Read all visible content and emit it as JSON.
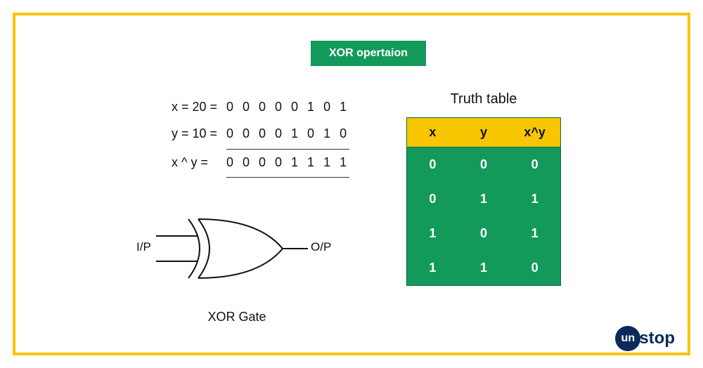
{
  "title": "XOR opertaion",
  "equations": {
    "x_label": "x = 20 =",
    "x_bits": "0 0 0 0 0 1 0 1",
    "y_label": "y = 10 =",
    "y_bits": "0 0 0 0 1 0 1 0",
    "res_label": "x ^ y  =",
    "res_bits": "0 0 0 0 1 1 1 1"
  },
  "gate": {
    "input_label": "I/P",
    "output_label": "O/P",
    "caption": "XOR Gate"
  },
  "truth": {
    "title": "Truth table",
    "headers": [
      "x",
      "y",
      "x^y"
    ],
    "rows": [
      [
        "0",
        "0",
        "0"
      ],
      [
        "0",
        "1",
        "1"
      ],
      [
        "1",
        "0",
        "1"
      ],
      [
        "1",
        "1",
        "0"
      ]
    ]
  },
  "logo": {
    "bubble": "un",
    "rest": "stop"
  },
  "colors": {
    "accent_yellow": "#f7c600",
    "brand_green": "#139a5b",
    "brand_navy": "#0b2a5b"
  }
}
